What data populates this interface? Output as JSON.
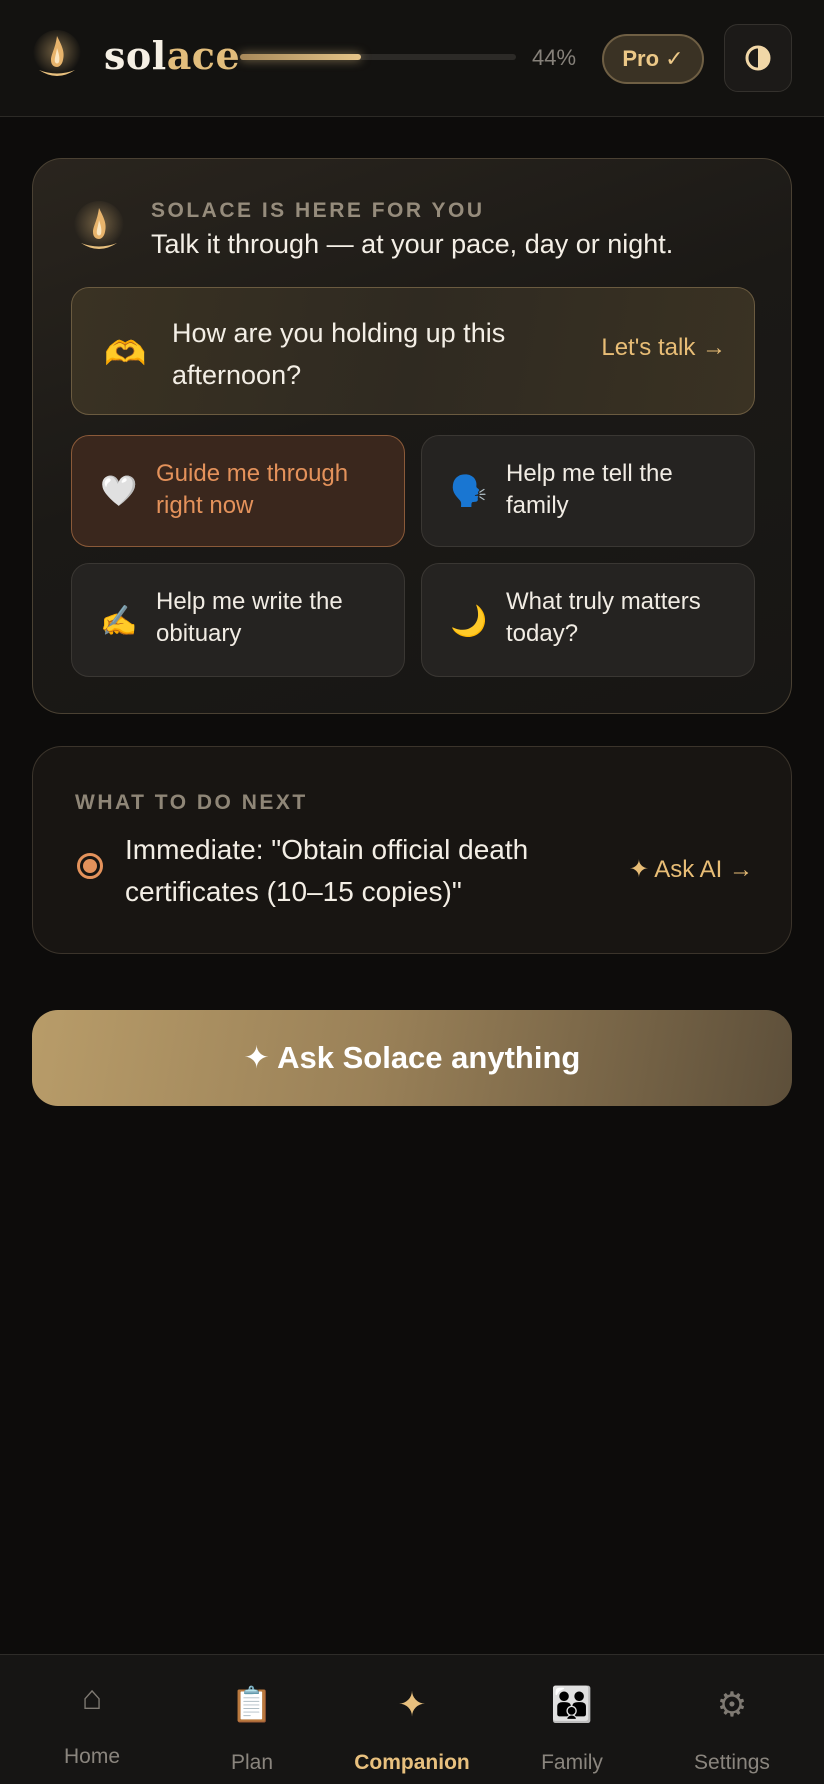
{
  "header": {
    "brand_part1": "sol",
    "brand_part2": "ace",
    "progress_percent": 44,
    "progress_text": "44%",
    "pro_badge": "Pro ✓",
    "theme_icon": "contrast-icon"
  },
  "companion": {
    "eyebrow": "SOLACE IS HERE FOR YOU",
    "title": "Talk it through — at your pace, day or night.",
    "prompt": {
      "icon": "🫶",
      "text": "How are you holding up this afternoon?",
      "cta": "Let's talk →"
    },
    "options": [
      {
        "icon": "🤍",
        "label": "Guide me through right now",
        "active": true
      },
      {
        "icon": "🗣️",
        "label": "Help me tell the family",
        "active": false
      },
      {
        "icon": "✍️",
        "label": "Help me write the obituary",
        "active": false
      },
      {
        "icon": "🌙",
        "label": "What truly matters today?",
        "active": false
      }
    ]
  },
  "next": {
    "eyebrow": "WHAT TO DO NEXT",
    "text": "Immediate: \"Obtain official death certificates (10–15 copies)\"",
    "cta": "✦ Ask AI →"
  },
  "ask_button": "✦ Ask Solace anything",
  "colors": {
    "accent_gold": "#e8bd76",
    "accent_orange": "#e4925b",
    "background": "#0d0c0b"
  },
  "nav": [
    {
      "icon": "⌂",
      "icon_name": "home-icon",
      "label": "Home",
      "active": false
    },
    {
      "icon": "📋",
      "icon_name": "clipboard-icon",
      "label": "Plan",
      "active": false
    },
    {
      "icon": "✦",
      "icon_name": "sparkle-icon",
      "label": "Companion",
      "active": true
    },
    {
      "icon": "👪",
      "icon_name": "family-icon",
      "label": "Family",
      "active": false
    },
    {
      "icon": "⚙",
      "icon_name": "gear-icon",
      "label": "Settings",
      "active": false
    }
  ]
}
